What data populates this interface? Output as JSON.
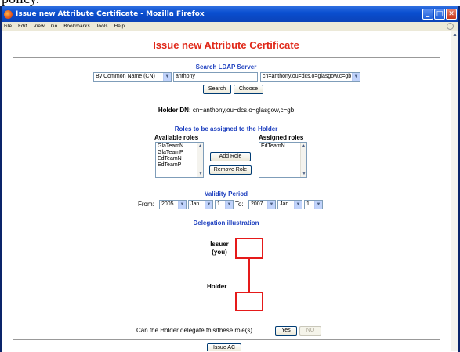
{
  "top_strip_text": "policy.",
  "window": {
    "title": "Issue new Attribute Certificate - Mozilla Firefox",
    "controls": {
      "minimize": "_",
      "maximize": "□",
      "close": "✕"
    }
  },
  "menu": [
    "File",
    "Edit",
    "View",
    "Go",
    "Bookmarks",
    "Tools",
    "Help"
  ],
  "page": {
    "title": "Issue new Attribute Certificate",
    "search": {
      "section_title": "Search LDAP Server",
      "search_by": "By Common Name (CN)",
      "query": "anthony",
      "result_dn": "cn=anthony,ou=dcs,o=glasgow,c=gb",
      "search_button": "Search",
      "choose_button": "Choose"
    },
    "holder": {
      "label": "Holder DN:",
      "value": "cn=anthony,ou=dcs,o=glasgow,c=gb"
    },
    "roles": {
      "section_title": "Roles to be assigned to the Holder",
      "available_label": "Available roles",
      "assigned_label": "Assigned roles",
      "available": [
        "GlaTeamN",
        "GlaTeamP",
        "EdTeamN",
        "EdTeamP"
      ],
      "assigned": [
        "EdTeamN"
      ],
      "add_button": "Add Role",
      "remove_button": "Remove Role"
    },
    "validity": {
      "section_title": "Validity Period",
      "from_label": "From:",
      "from_year": "2005",
      "from_month": "Jan",
      "from_day": "1",
      "to_label": "To:",
      "to_year": "2007",
      "to_month": "Jan",
      "to_day": "1"
    },
    "delegation": {
      "section_title": "Delegation illustration",
      "issuer_label": "Issuer",
      "issuer_sub": "(you)",
      "holder_label": "Holder",
      "question": "Can the Holder delegate this/these role(s)",
      "yes_button": "Yes",
      "no_button": "NO"
    },
    "issue_button": "Issue AC"
  },
  "colors": {
    "title_red": "#e0291a",
    "section_blue": "#1d3fbf",
    "diagram_red": "#e51a1a"
  }
}
